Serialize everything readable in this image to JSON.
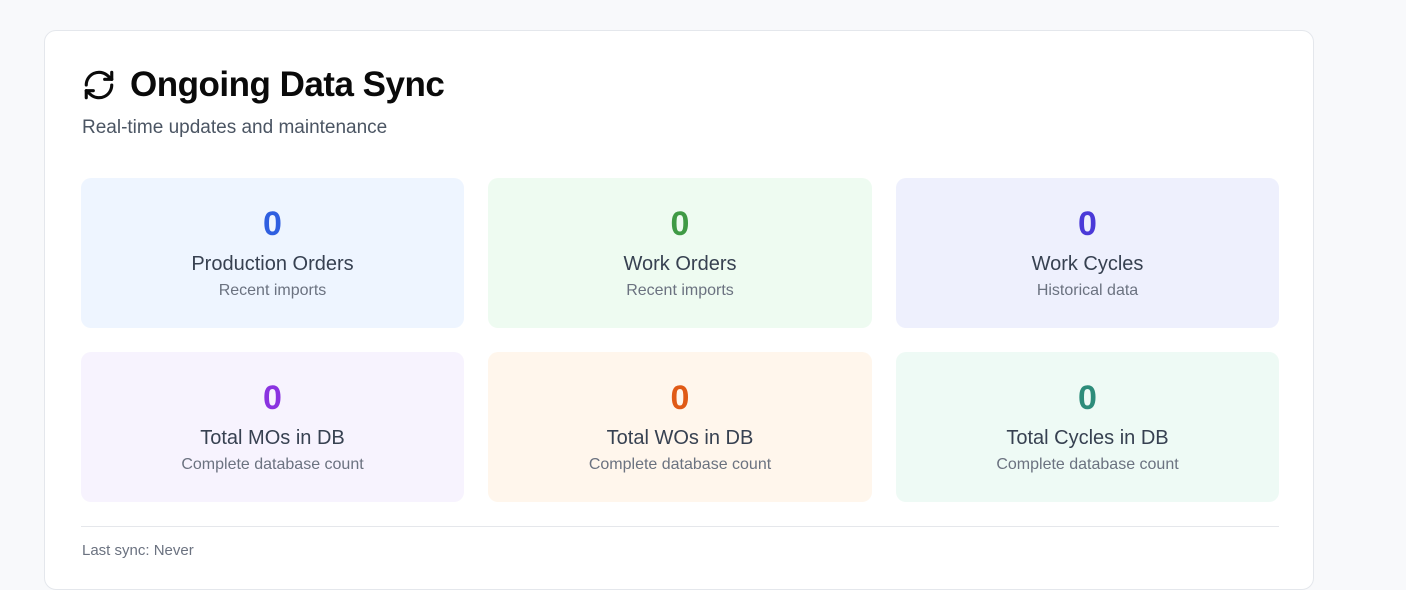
{
  "header": {
    "title": "Ongoing Data Sync",
    "subtitle": "Real-time updates and maintenance",
    "icon": "refresh-icon"
  },
  "stats": [
    {
      "value": "0",
      "label": "Production Orders",
      "sub": "Recent imports",
      "color": "#2f5fe0",
      "bg": "#eef5ff"
    },
    {
      "value": "0",
      "label": "Work Orders",
      "sub": "Recent imports",
      "color": "#3f9a45",
      "bg": "#eefbf1"
    },
    {
      "value": "0",
      "label": "Work Cycles",
      "sub": "Historical data",
      "color": "#4a39d8",
      "bg": "#eef0fd"
    },
    {
      "value": "0",
      "label": "Total MOs in DB",
      "sub": "Complete database count",
      "color": "#8a33e0",
      "bg": "#f7f3fe"
    },
    {
      "value": "0",
      "label": "Total WOs in DB",
      "sub": "Complete database count",
      "color": "#e05a16",
      "bg": "#fff6ec"
    },
    {
      "value": "0",
      "label": "Total Cycles in DB",
      "sub": "Complete database count",
      "color": "#2d8c7a",
      "bg": "#eefaf5"
    }
  ],
  "footer": {
    "last_sync": "Last sync: Never"
  }
}
